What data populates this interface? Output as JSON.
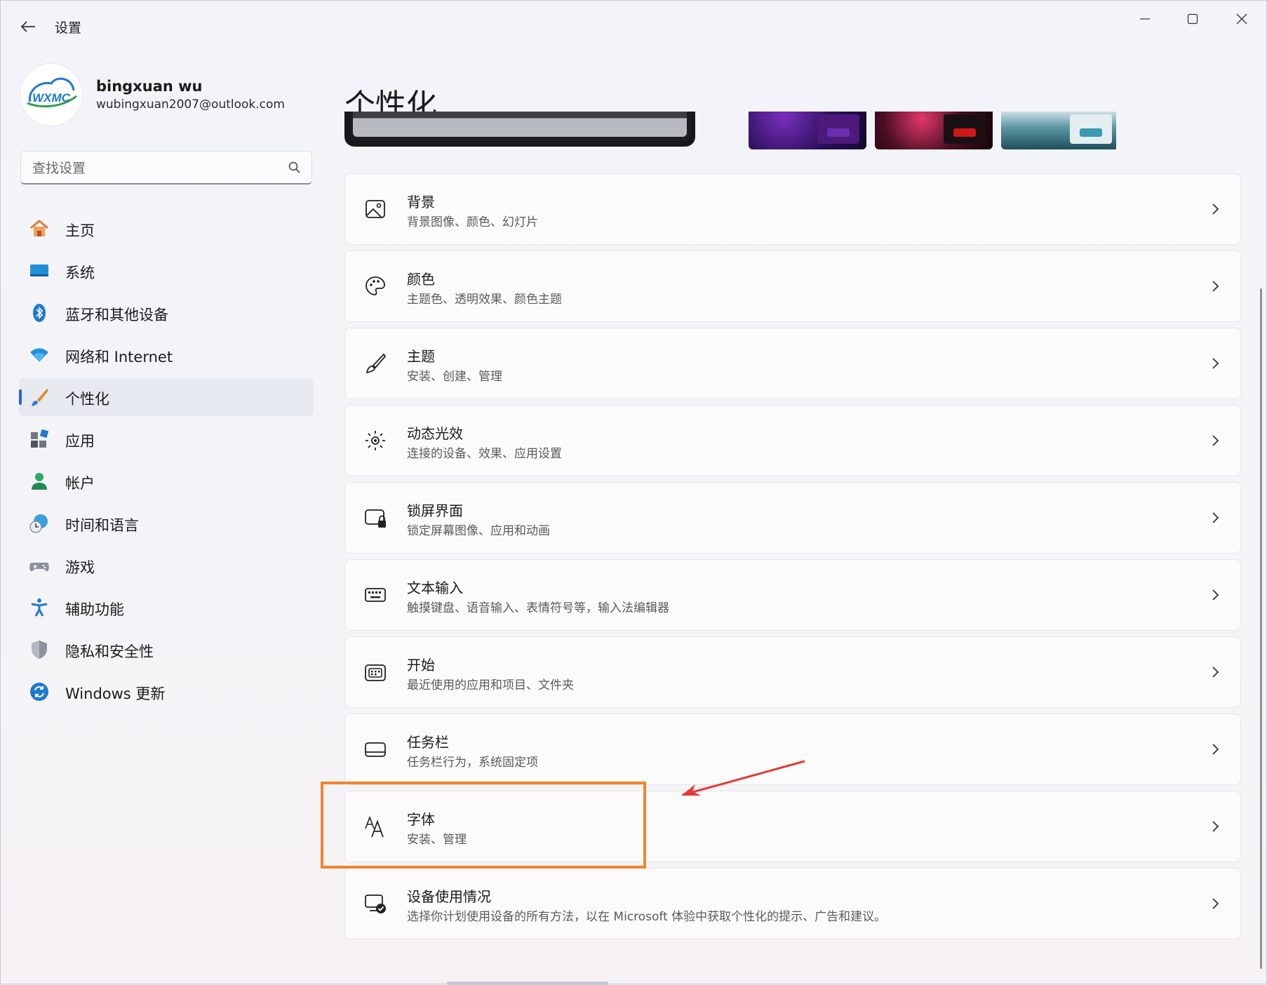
{
  "window": {
    "title": "设置",
    "controls": [
      "minimize-icon",
      "maximize-icon",
      "close-icon"
    ]
  },
  "user": {
    "name": "bingxuan wu",
    "email": "wubingxuan2007@outlook.com",
    "avatar_text": "WXMC"
  },
  "search": {
    "placeholder": "查找设置"
  },
  "sidebar": {
    "items": [
      {
        "label": "主页",
        "icon": "home-icon",
        "selected": false
      },
      {
        "label": "系统",
        "icon": "system-icon",
        "selected": false
      },
      {
        "label": "蓝牙和其他设备",
        "icon": "bluetooth-icon",
        "selected": false
      },
      {
        "label": "网络和 Internet",
        "icon": "wifi-icon",
        "selected": false
      },
      {
        "label": "个性化",
        "icon": "brush-icon",
        "selected": true
      },
      {
        "label": "应用",
        "icon": "apps-icon",
        "selected": false
      },
      {
        "label": "帐户",
        "icon": "account-icon",
        "selected": false
      },
      {
        "label": "时间和语言",
        "icon": "globe-clock-icon",
        "selected": false
      },
      {
        "label": "游戏",
        "icon": "gamepad-icon",
        "selected": false
      },
      {
        "label": "辅助功能",
        "icon": "accessibility-icon",
        "selected": false
      },
      {
        "label": "隐私和安全性",
        "icon": "shield-icon",
        "selected": false
      },
      {
        "label": "Windows 更新",
        "icon": "update-icon",
        "selected": false
      }
    ]
  },
  "main": {
    "title": "个性化",
    "settings": [
      {
        "title": "背景",
        "desc": "背景图像、颜色、幻灯片",
        "icon": "image-icon"
      },
      {
        "title": "颜色",
        "desc": "主题色、透明效果、颜色主题",
        "icon": "palette-icon"
      },
      {
        "title": "主题",
        "desc": "安装、创建、管理",
        "icon": "brush-outline-icon"
      },
      {
        "title": "动态光效",
        "desc": "连接的设备、效果、应用设置",
        "icon": "sun-lighting-icon"
      },
      {
        "title": "锁屏界面",
        "desc": "锁定屏幕图像、应用和动画",
        "icon": "lock-screen-icon"
      },
      {
        "title": "文本输入",
        "desc": "触摸键盘、语音输入、表情符号等，输入法编辑器",
        "icon": "keyboard-icon"
      },
      {
        "title": "开始",
        "desc": "最近使用的应用和项目、文件夹",
        "icon": "start-menu-icon"
      },
      {
        "title": "任务栏",
        "desc": "任务栏行为，系统固定项",
        "icon": "taskbar-icon"
      },
      {
        "title": "字体",
        "desc": "安装、管理",
        "icon": "font-icon"
      },
      {
        "title": "设备使用情况",
        "desc": "选择你计划使用设备的所有方法，以在 Microsoft 体验中获取个性化的提示、广告和建议。",
        "icon": "device-usage-icon"
      }
    ]
  },
  "colors": {
    "accent": "#2a62c8",
    "highlight_box": "#f0852d",
    "arrow": "#e53935"
  }
}
